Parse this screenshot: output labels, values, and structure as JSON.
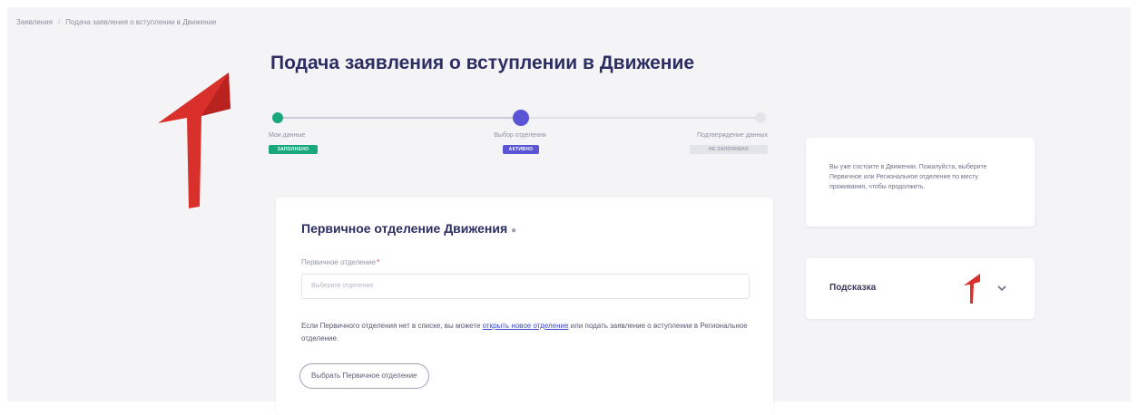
{
  "breadcrumb": {
    "items": [
      "Заявления",
      "Подача заявления о вступлении в Движение"
    ]
  },
  "page": {
    "title": "Подача заявления о вступлении в Движение"
  },
  "stepper": {
    "steps": [
      {
        "label": "Мои данные",
        "status": "ЗАПОЛНЕНО",
        "state": "done",
        "color": "#1aa77b"
      },
      {
        "label": "Выбор отделения",
        "status": "АКТИВНО",
        "state": "active",
        "color": "#5a55d6"
      },
      {
        "label": "Подтверждение данных",
        "status": "НЕ ЗАПОЛНЕНО",
        "state": "pending",
        "color": "#e3e4e9"
      }
    ]
  },
  "form": {
    "title": "Первичное отделение Движения",
    "info_icon": "info-icon",
    "field_label": "Первичное отделение",
    "required_mark": "*",
    "select_placeholder": "Выберите отделение",
    "note_before": "Если Первичного отделения нет в списке, вы можете ",
    "note_link": "открыть новое отделение",
    "note_after": " или подать заявление о вступлении в Региональное отделение.",
    "choose_button": "Выбрать Первичное отделение"
  },
  "sidebar": {
    "info_text": "Вы уже состоите в Движении. Пожалуйста, выберите Первичное или Региональное отделение по месту проживания, чтобы продолжить.",
    "hint_title": "Подсказка",
    "hint_icon": "chevron-down-icon"
  },
  "colors": {
    "accent": "#5a55d6",
    "success": "#1aa77b",
    "title": "#2c2e63",
    "annotation_arrow": "#d9302b"
  }
}
